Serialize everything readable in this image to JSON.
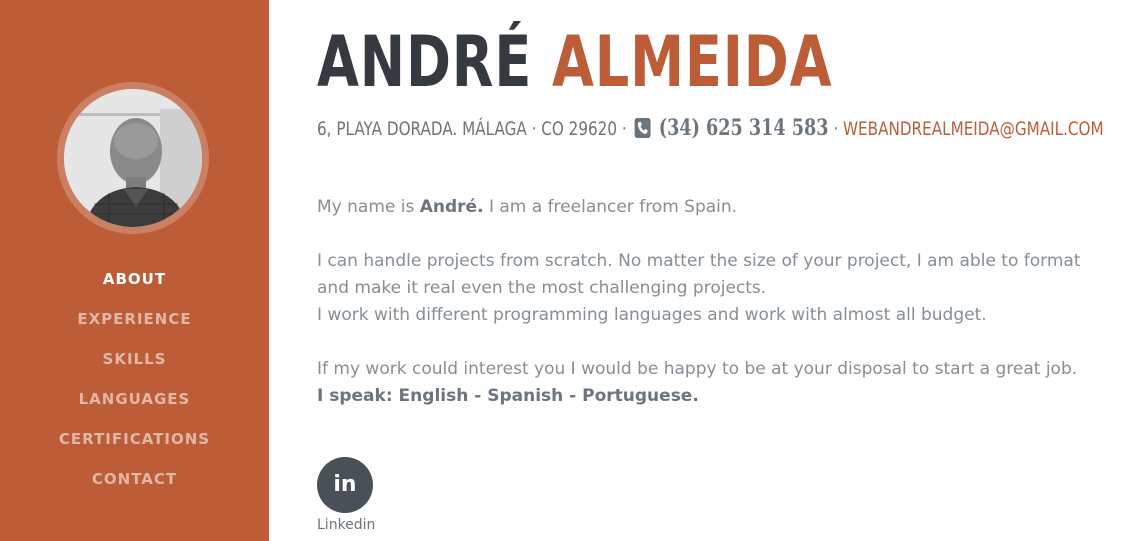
{
  "sidebar": {
    "avatar_alt": "Profile photo",
    "items": [
      {
        "label": "ABOUT",
        "active": true
      },
      {
        "label": "EXPERIENCE",
        "active": false
      },
      {
        "label": "SKILLS",
        "active": false
      },
      {
        "label": "LANGUAGES",
        "active": false
      },
      {
        "label": "CERTIFICATIONS",
        "active": false
      },
      {
        "label": "CONTACT",
        "active": false
      }
    ]
  },
  "header": {
    "first_name": "ANDRÉ",
    "last_name": "ALMEIDA",
    "address": "6, PLAYA DORADA. MÁLAGA · CO 29620 ·",
    "phone": "(34) 625 314 583",
    "separator": "·",
    "email": "WEBANDREALMEIDA@GMAIL.COM",
    "phone_icon": "phone-square-icon"
  },
  "bio": {
    "line1_prefix": "My name is ",
    "line1_name": "André.",
    "line1_suffix": " I am a freelancer from Spain.",
    "paragraph2_line1": "I can handle projects from scratch. No matter the size of your project, I am able to format and make it real even the most challenging projects.",
    "paragraph2_line2": "I work with different programming languages and work with almost all budget.",
    "paragraph3_line1": "If my work could interest you I would be happy to be at your disposal to start a great job.",
    "paragraph3_line2": "I speak: English - Spanish - Portuguese."
  },
  "social": {
    "icon_text": "in",
    "icon_name": "linkedin-icon",
    "label": "Linkedin"
  },
  "colors": {
    "accent": "#bd5d38",
    "dark": "#343a40",
    "muted": "#868e96"
  }
}
